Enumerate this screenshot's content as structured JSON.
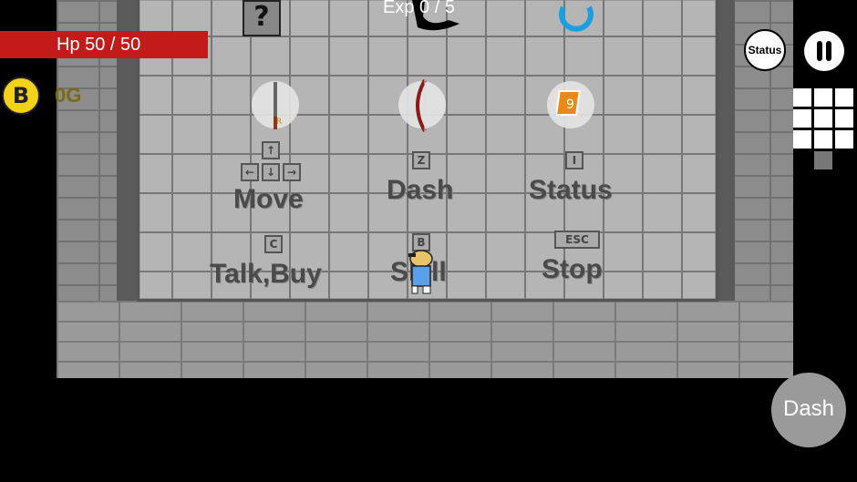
{
  "hud": {
    "hp_text": "Hp 50 / 50",
    "hp_current": 50,
    "hp_max": 50,
    "exp_text": "Exp 0 / 5",
    "coin_symbol": "B",
    "gold_text": "0G",
    "status_button": "Status",
    "dash_button": "Dash"
  },
  "tutorial": {
    "move": {
      "label": "Move"
    },
    "dash": {
      "label": "Dash",
      "key": "Z"
    },
    "status": {
      "label": "Status",
      "key": "I"
    },
    "talk_buy": {
      "label": "Talk,Buy",
      "key": "C"
    },
    "skill": {
      "label": "Skill",
      "key": "B"
    },
    "stop": {
      "label": "Stop",
      "key": "ESC"
    },
    "mystery_box": "?"
  },
  "icons": {
    "sword": "sword-icon",
    "bow": "bow-icon",
    "scroll": "scroll-icon",
    "portal": "portal-icon",
    "coin": "bitcoin-coin-icon",
    "pause": "pause-icon"
  },
  "colors": {
    "hp_bar": "#c41a1a",
    "coin": "#f2d21a",
    "portal": "#1aa0e0"
  }
}
